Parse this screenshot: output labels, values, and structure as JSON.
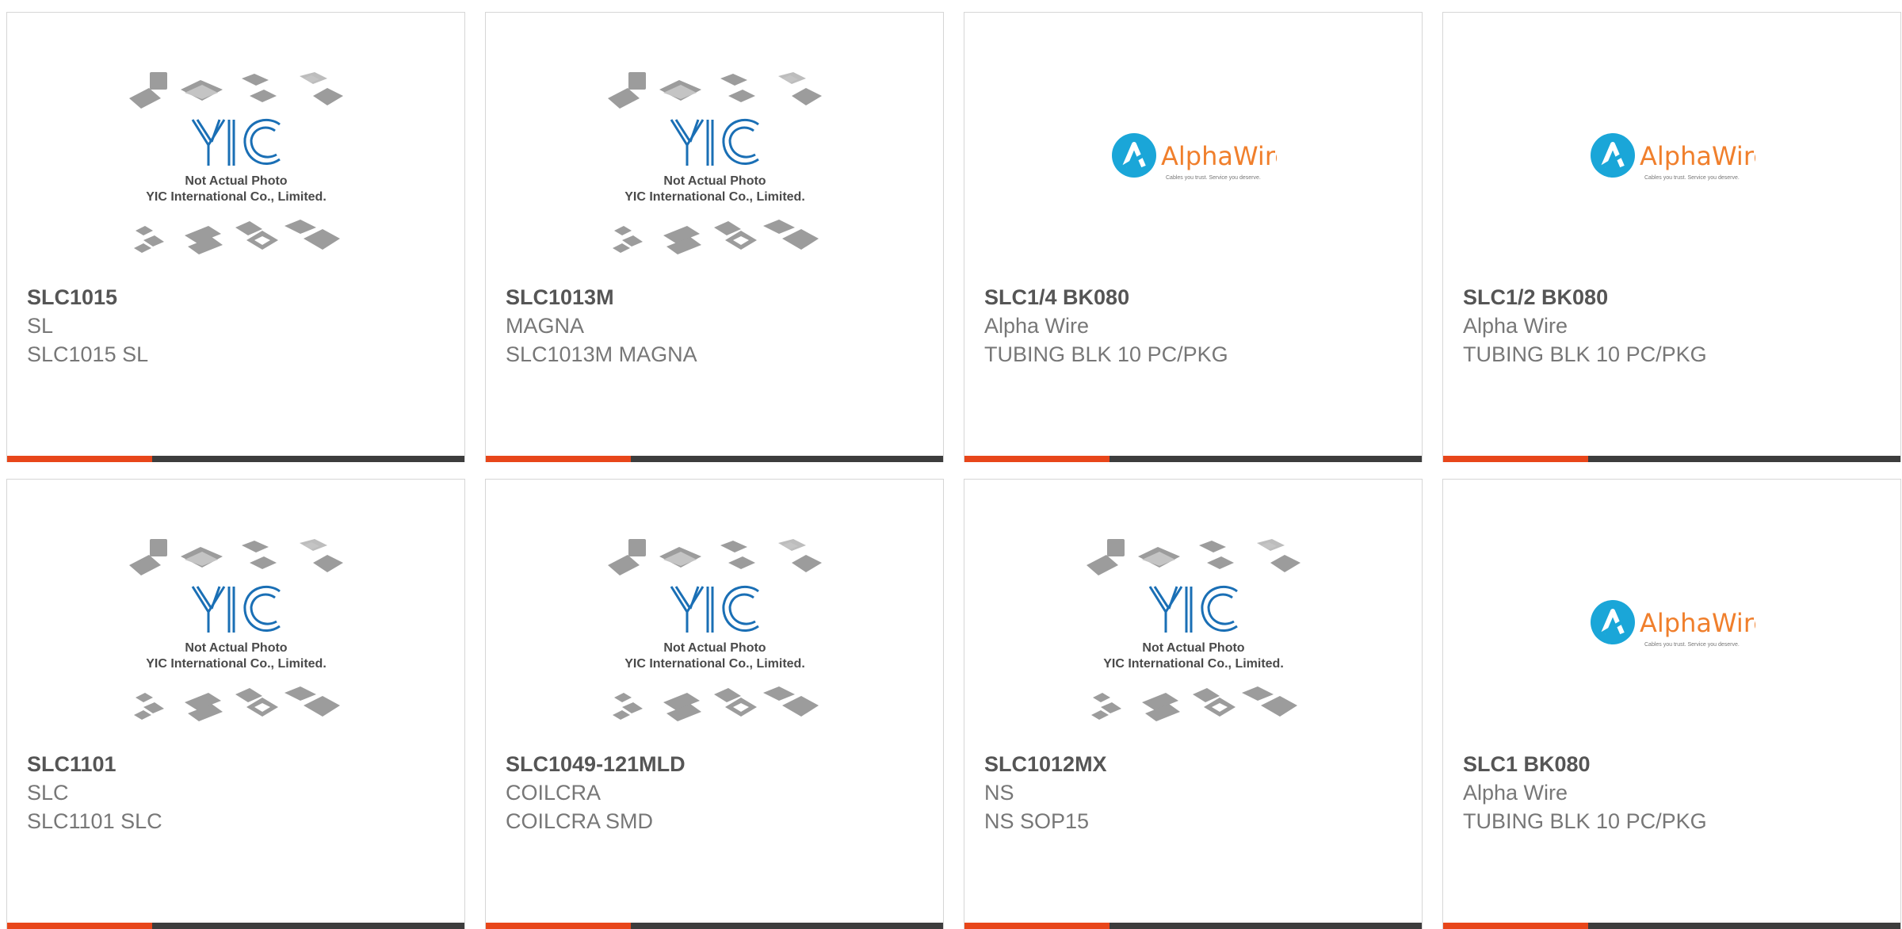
{
  "colors": {
    "accent": "#e8461a",
    "bar": "#3d3d3d",
    "border": "#d6d6d6",
    "part_text": "#555555",
    "secondary_text": "#777777",
    "yic_blue": "#1a6fb5",
    "alphawire_blue": "#1aa6d8",
    "alphawire_orange": "#f07f2c"
  },
  "placeholder": {
    "caption_line1": "Not Actual Photo",
    "caption_line2": "YIC International Co., Limited.",
    "logo_text": "YIC"
  },
  "alphawire": {
    "brand": "AlphaWire",
    "tagline": "Cables you trust. Service you deserve."
  },
  "products": [
    {
      "part": "SLC1015",
      "manufacturer": "SL",
      "description": "SLC1015 SL",
      "image": "yic-placeholder-icon"
    },
    {
      "part": "SLC1013M",
      "manufacturer": "MAGNA",
      "description": "SLC1013M MAGNA",
      "image": "yic-placeholder-icon"
    },
    {
      "part": "SLC1/4 BK080",
      "manufacturer": "Alpha Wire",
      "description": "TUBING BLK 10 PC/PKG",
      "image": "alphawire-logo-icon"
    },
    {
      "part": "SLC1/2 BK080",
      "manufacturer": "Alpha Wire",
      "description": "TUBING BLK 10 PC/PKG",
      "image": "alphawire-logo-icon"
    },
    {
      "part": "SLC1101",
      "manufacturer": "SLC",
      "description": "SLC1101 SLC",
      "image": "yic-placeholder-icon"
    },
    {
      "part": "SLC1049-121MLD",
      "manufacturer": "COILCRA",
      "description": "COILCRA SMD",
      "image": "yic-placeholder-icon"
    },
    {
      "part": "SLC1012MX",
      "manufacturer": "NS",
      "description": "NS SOP15",
      "image": "yic-placeholder-icon"
    },
    {
      "part": "SLC1 BK080",
      "manufacturer": "Alpha Wire",
      "description": "TUBING BLK 10 PC/PKG",
      "image": "alphawire-logo-icon"
    }
  ]
}
